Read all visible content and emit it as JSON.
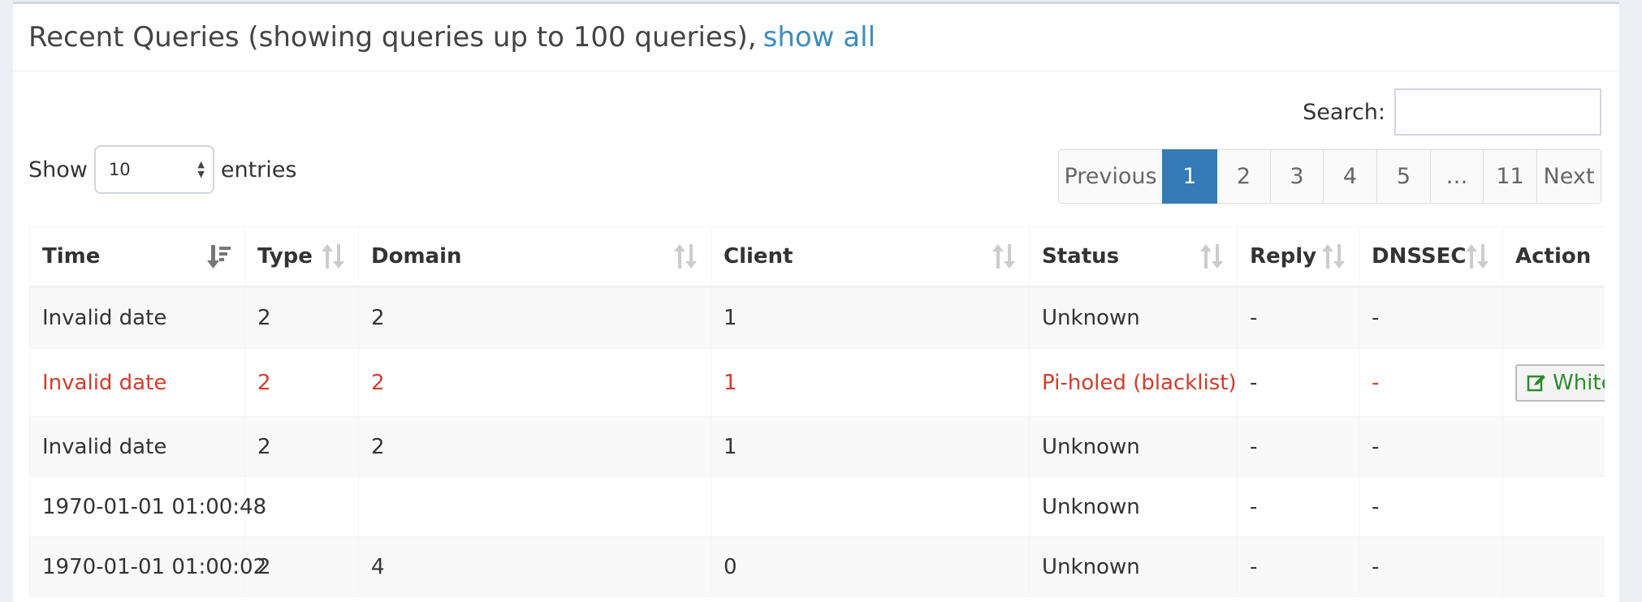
{
  "header": {
    "title": "Recent Queries (showing queries up to 100 queries),",
    "show_all_link": "show all"
  },
  "controls": {
    "search_label": "Search:",
    "search_value": "",
    "show_label": "Show",
    "entries_value": "10",
    "entries_label": "entries"
  },
  "pagination": {
    "previous": "Previous",
    "pages": [
      "1",
      "2",
      "3",
      "4",
      "5",
      "…",
      "11"
    ],
    "active_page": "1",
    "next": "Next"
  },
  "table": {
    "columns": [
      "Time",
      "Type",
      "Domain",
      "Client",
      "Status",
      "Reply",
      "DNSSEC",
      "Action"
    ],
    "rows": [
      {
        "time": "Invalid date",
        "type": "2",
        "domain": "2",
        "client": "1",
        "status": "Unknown",
        "reply": "-",
        "dnssec": "-",
        "action": "",
        "blocked": false
      },
      {
        "time": "Invalid date",
        "type": "2",
        "domain": "2",
        "client": "1",
        "status": "Pi-holed (blacklist)",
        "reply": "-",
        "dnssec": "-",
        "action": "Whitelist",
        "blocked": true
      },
      {
        "time": "Invalid date",
        "type": "2",
        "domain": "2",
        "client": "1",
        "status": "Unknown",
        "reply": "-",
        "dnssec": "-",
        "action": "",
        "blocked": false
      },
      {
        "time": "1970-01-01 01:00:48",
        "type": "",
        "domain": "",
        "client": "",
        "status": "Unknown",
        "reply": "-",
        "dnssec": "-",
        "action": "",
        "blocked": false
      },
      {
        "time": "1970-01-01 01:00:02",
        "type": "2",
        "domain": "4",
        "client": "0",
        "status": "Unknown",
        "reply": "-",
        "dnssec": "-",
        "action": "",
        "blocked": false
      }
    ]
  },
  "colors": {
    "link": "#3c8dbc",
    "active_page": "#337ab7",
    "blocked_text": "#d13d2e",
    "whitelist_text": "#2e8b2e"
  },
  "icons": {
    "sort_active": "sort-amount-desc-icon",
    "sort_inactive": "sort-both-icon",
    "select_arrows": "select-arrows-icon",
    "whitelist": "edit-icon"
  }
}
